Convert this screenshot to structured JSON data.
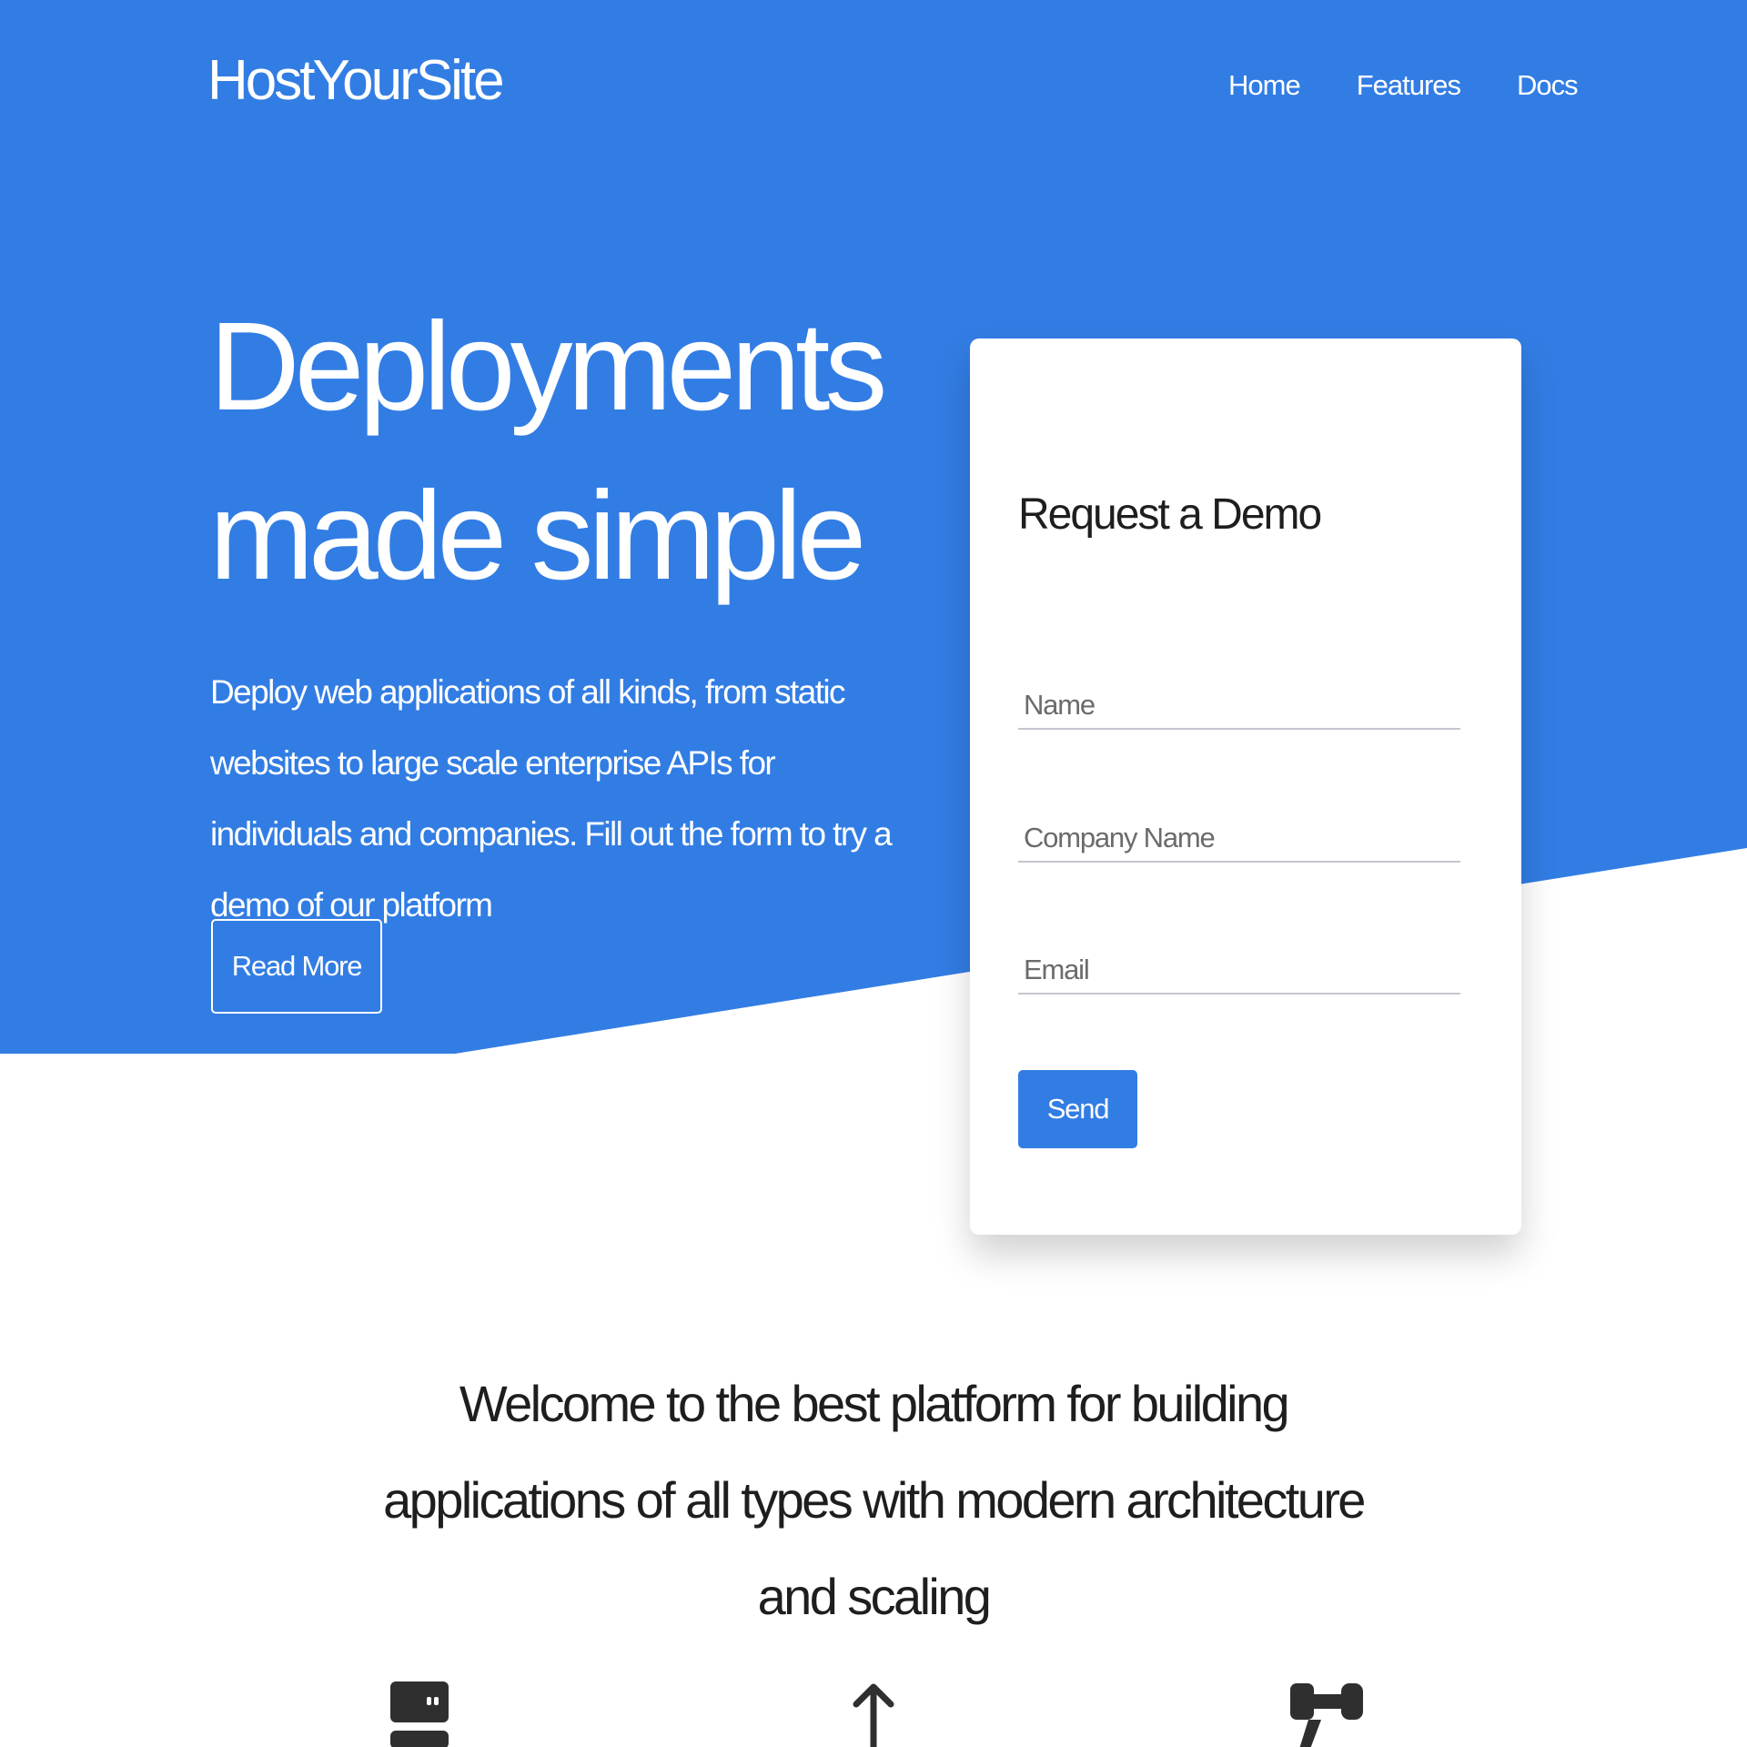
{
  "brand": {
    "logo": "HostYourSite",
    "primary_color": "#327de4"
  },
  "nav": {
    "items": [
      {
        "label": "Home"
      },
      {
        "label": "Features"
      },
      {
        "label": "Docs"
      }
    ]
  },
  "hero": {
    "title": "Deployments made simple",
    "description": "Deploy web applications of all kinds, from static websites to large scale enterprise APIs for individuals and companies. Fill out the form to try a demo of our platform",
    "read_more_label": "Read More"
  },
  "demo_form": {
    "title": "Request a Demo",
    "name_placeholder": "Name",
    "company_placeholder": "Company Name",
    "email_placeholder": "Email",
    "send_label": "Send"
  },
  "welcome": {
    "text": "Welcome to the best platform for building applications of all types with modern architecture and scaling"
  },
  "features": {
    "icons": [
      "server-icon",
      "arrow-up-icon",
      "hammer-icon"
    ]
  }
}
